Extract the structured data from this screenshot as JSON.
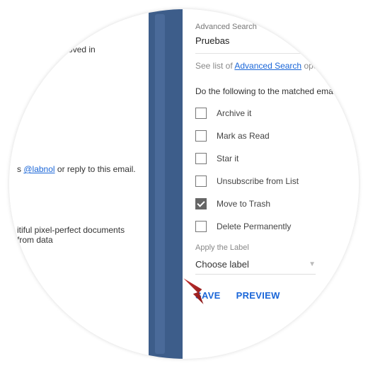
{
  "left": {
    "t1": "er is also removed in",
    "t2_prefix": "s ",
    "t2_link": "@labnol",
    "t2_suffix": " or reply to this email.",
    "t3": "itiful pixel-perfect documents from data"
  },
  "right": {
    "adv_label": "Advanced Search",
    "adv_value": "Pruebas",
    "see_prefix": "See list of ",
    "see_link": "Advanced Search",
    "see_suffix": " operators",
    "do_label": "Do the following to the matched emails:",
    "checks": [
      {
        "label": "Archive it",
        "checked": false
      },
      {
        "label": "Mark as Read",
        "checked": false
      },
      {
        "label": "Star it",
        "checked": false
      },
      {
        "label": "Unsubscribe from List",
        "checked": false
      },
      {
        "label": "Move to Trash",
        "checked": true
      },
      {
        "label": "Delete Permanently",
        "checked": false
      }
    ],
    "apply_label": "Apply the Label",
    "dropdown": "Choose label",
    "save": "SAVE",
    "preview": "PREVIEW"
  }
}
